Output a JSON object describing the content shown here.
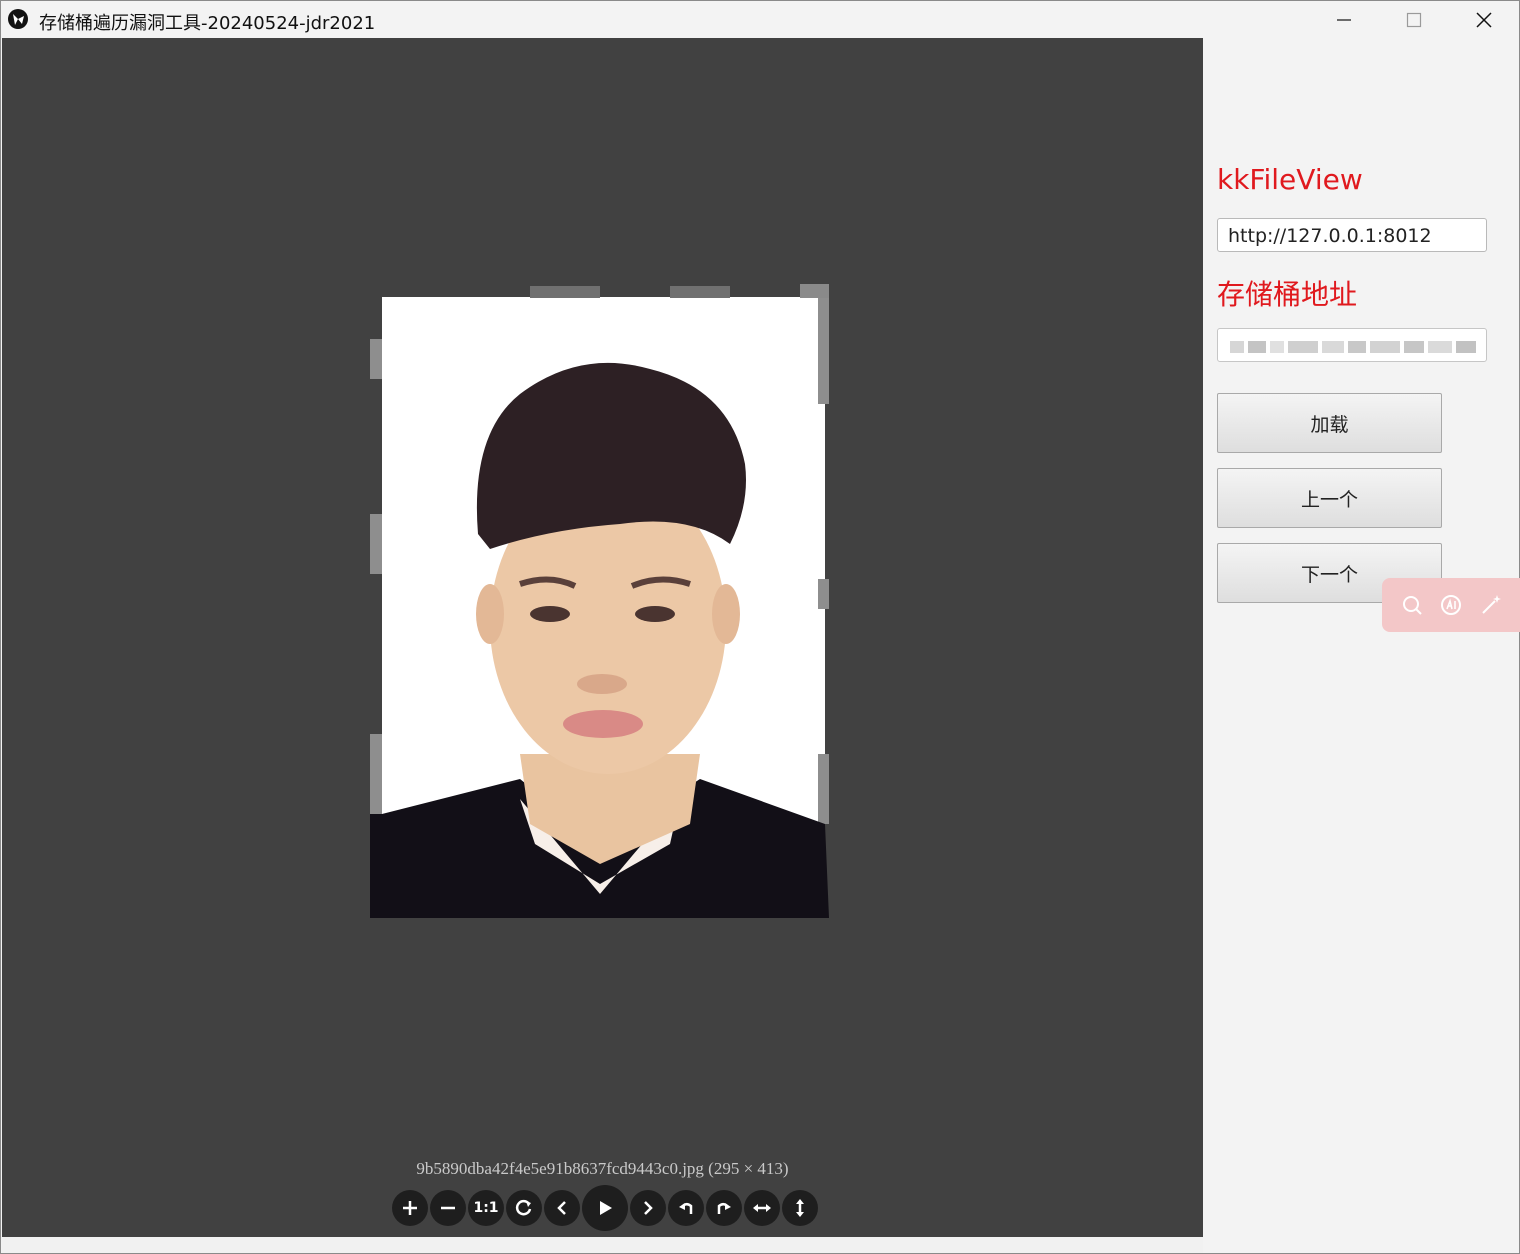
{
  "window": {
    "title": "存储桶遍历漏洞工具-20240524-jdr2021"
  },
  "viewer": {
    "caption": "9b5890dba42f4e5e91b8637fcd9443c0.jpg (295 × 413)",
    "toolbar": [
      "zoom-in-icon",
      "zoom-out-icon",
      "one-to-one-icon",
      "reset-icon",
      "previous-icon",
      "play-icon",
      "next-icon",
      "rotate-left-icon",
      "rotate-right-icon",
      "flip-horizontal-icon",
      "flip-vertical-icon"
    ],
    "toolbar_one_to_one_text": "1:1"
  },
  "panel": {
    "kkfileview_label": "kkFileView",
    "kkfileview_value": "http://127.0.0.1:8012",
    "bucket_label": "存储桶地址",
    "load_button": "加载",
    "prev_button": "上一个",
    "next_button": "下一个"
  },
  "colors": {
    "label_red": "#e0191e",
    "viewer_bg": "#414141"
  }
}
